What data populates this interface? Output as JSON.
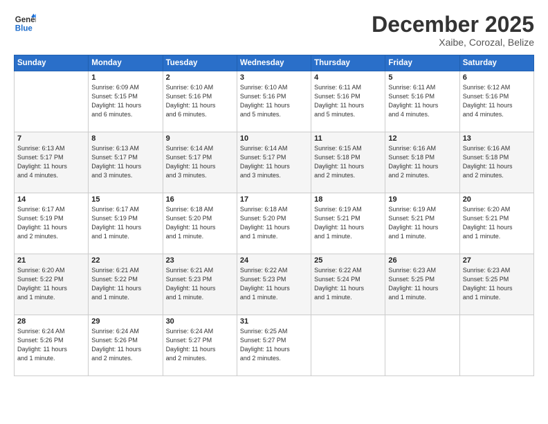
{
  "header": {
    "logo_line1": "General",
    "logo_line2": "Blue",
    "month": "December 2025",
    "location": "Xaibe, Corozal, Belize"
  },
  "weekdays": [
    "Sunday",
    "Monday",
    "Tuesday",
    "Wednesday",
    "Thursday",
    "Friday",
    "Saturday"
  ],
  "weeks": [
    [
      {
        "day": "",
        "info": ""
      },
      {
        "day": "1",
        "info": "Sunrise: 6:09 AM\nSunset: 5:15 PM\nDaylight: 11 hours\nand 6 minutes."
      },
      {
        "day": "2",
        "info": "Sunrise: 6:10 AM\nSunset: 5:16 PM\nDaylight: 11 hours\nand 6 minutes."
      },
      {
        "day": "3",
        "info": "Sunrise: 6:10 AM\nSunset: 5:16 PM\nDaylight: 11 hours\nand 5 minutes."
      },
      {
        "day": "4",
        "info": "Sunrise: 6:11 AM\nSunset: 5:16 PM\nDaylight: 11 hours\nand 5 minutes."
      },
      {
        "day": "5",
        "info": "Sunrise: 6:11 AM\nSunset: 5:16 PM\nDaylight: 11 hours\nand 4 minutes."
      },
      {
        "day": "6",
        "info": "Sunrise: 6:12 AM\nSunset: 5:16 PM\nDaylight: 11 hours\nand 4 minutes."
      }
    ],
    [
      {
        "day": "7",
        "info": "Sunrise: 6:13 AM\nSunset: 5:17 PM\nDaylight: 11 hours\nand 4 minutes."
      },
      {
        "day": "8",
        "info": "Sunrise: 6:13 AM\nSunset: 5:17 PM\nDaylight: 11 hours\nand 3 minutes."
      },
      {
        "day": "9",
        "info": "Sunrise: 6:14 AM\nSunset: 5:17 PM\nDaylight: 11 hours\nand 3 minutes."
      },
      {
        "day": "10",
        "info": "Sunrise: 6:14 AM\nSunset: 5:17 PM\nDaylight: 11 hours\nand 3 minutes."
      },
      {
        "day": "11",
        "info": "Sunrise: 6:15 AM\nSunset: 5:18 PM\nDaylight: 11 hours\nand 2 minutes."
      },
      {
        "day": "12",
        "info": "Sunrise: 6:16 AM\nSunset: 5:18 PM\nDaylight: 11 hours\nand 2 minutes."
      },
      {
        "day": "13",
        "info": "Sunrise: 6:16 AM\nSunset: 5:18 PM\nDaylight: 11 hours\nand 2 minutes."
      }
    ],
    [
      {
        "day": "14",
        "info": "Sunrise: 6:17 AM\nSunset: 5:19 PM\nDaylight: 11 hours\nand 2 minutes."
      },
      {
        "day": "15",
        "info": "Sunrise: 6:17 AM\nSunset: 5:19 PM\nDaylight: 11 hours\nand 1 minute."
      },
      {
        "day": "16",
        "info": "Sunrise: 6:18 AM\nSunset: 5:20 PM\nDaylight: 11 hours\nand 1 minute."
      },
      {
        "day": "17",
        "info": "Sunrise: 6:18 AM\nSunset: 5:20 PM\nDaylight: 11 hours\nand 1 minute."
      },
      {
        "day": "18",
        "info": "Sunrise: 6:19 AM\nSunset: 5:21 PM\nDaylight: 11 hours\nand 1 minute."
      },
      {
        "day": "19",
        "info": "Sunrise: 6:19 AM\nSunset: 5:21 PM\nDaylight: 11 hours\nand 1 minute."
      },
      {
        "day": "20",
        "info": "Sunrise: 6:20 AM\nSunset: 5:21 PM\nDaylight: 11 hours\nand 1 minute."
      }
    ],
    [
      {
        "day": "21",
        "info": "Sunrise: 6:20 AM\nSunset: 5:22 PM\nDaylight: 11 hours\nand 1 minute."
      },
      {
        "day": "22",
        "info": "Sunrise: 6:21 AM\nSunset: 5:22 PM\nDaylight: 11 hours\nand 1 minute."
      },
      {
        "day": "23",
        "info": "Sunrise: 6:21 AM\nSunset: 5:23 PM\nDaylight: 11 hours\nand 1 minute."
      },
      {
        "day": "24",
        "info": "Sunrise: 6:22 AM\nSunset: 5:23 PM\nDaylight: 11 hours\nand 1 minute."
      },
      {
        "day": "25",
        "info": "Sunrise: 6:22 AM\nSunset: 5:24 PM\nDaylight: 11 hours\nand 1 minute."
      },
      {
        "day": "26",
        "info": "Sunrise: 6:23 AM\nSunset: 5:25 PM\nDaylight: 11 hours\nand 1 minute."
      },
      {
        "day": "27",
        "info": "Sunrise: 6:23 AM\nSunset: 5:25 PM\nDaylight: 11 hours\nand 1 minute."
      }
    ],
    [
      {
        "day": "28",
        "info": "Sunrise: 6:24 AM\nSunset: 5:26 PM\nDaylight: 11 hours\nand 1 minute."
      },
      {
        "day": "29",
        "info": "Sunrise: 6:24 AM\nSunset: 5:26 PM\nDaylight: 11 hours\nand 2 minutes."
      },
      {
        "day": "30",
        "info": "Sunrise: 6:24 AM\nSunset: 5:27 PM\nDaylight: 11 hours\nand 2 minutes."
      },
      {
        "day": "31",
        "info": "Sunrise: 6:25 AM\nSunset: 5:27 PM\nDaylight: 11 hours\nand 2 minutes."
      },
      {
        "day": "",
        "info": ""
      },
      {
        "day": "",
        "info": ""
      },
      {
        "day": "",
        "info": ""
      }
    ]
  ]
}
